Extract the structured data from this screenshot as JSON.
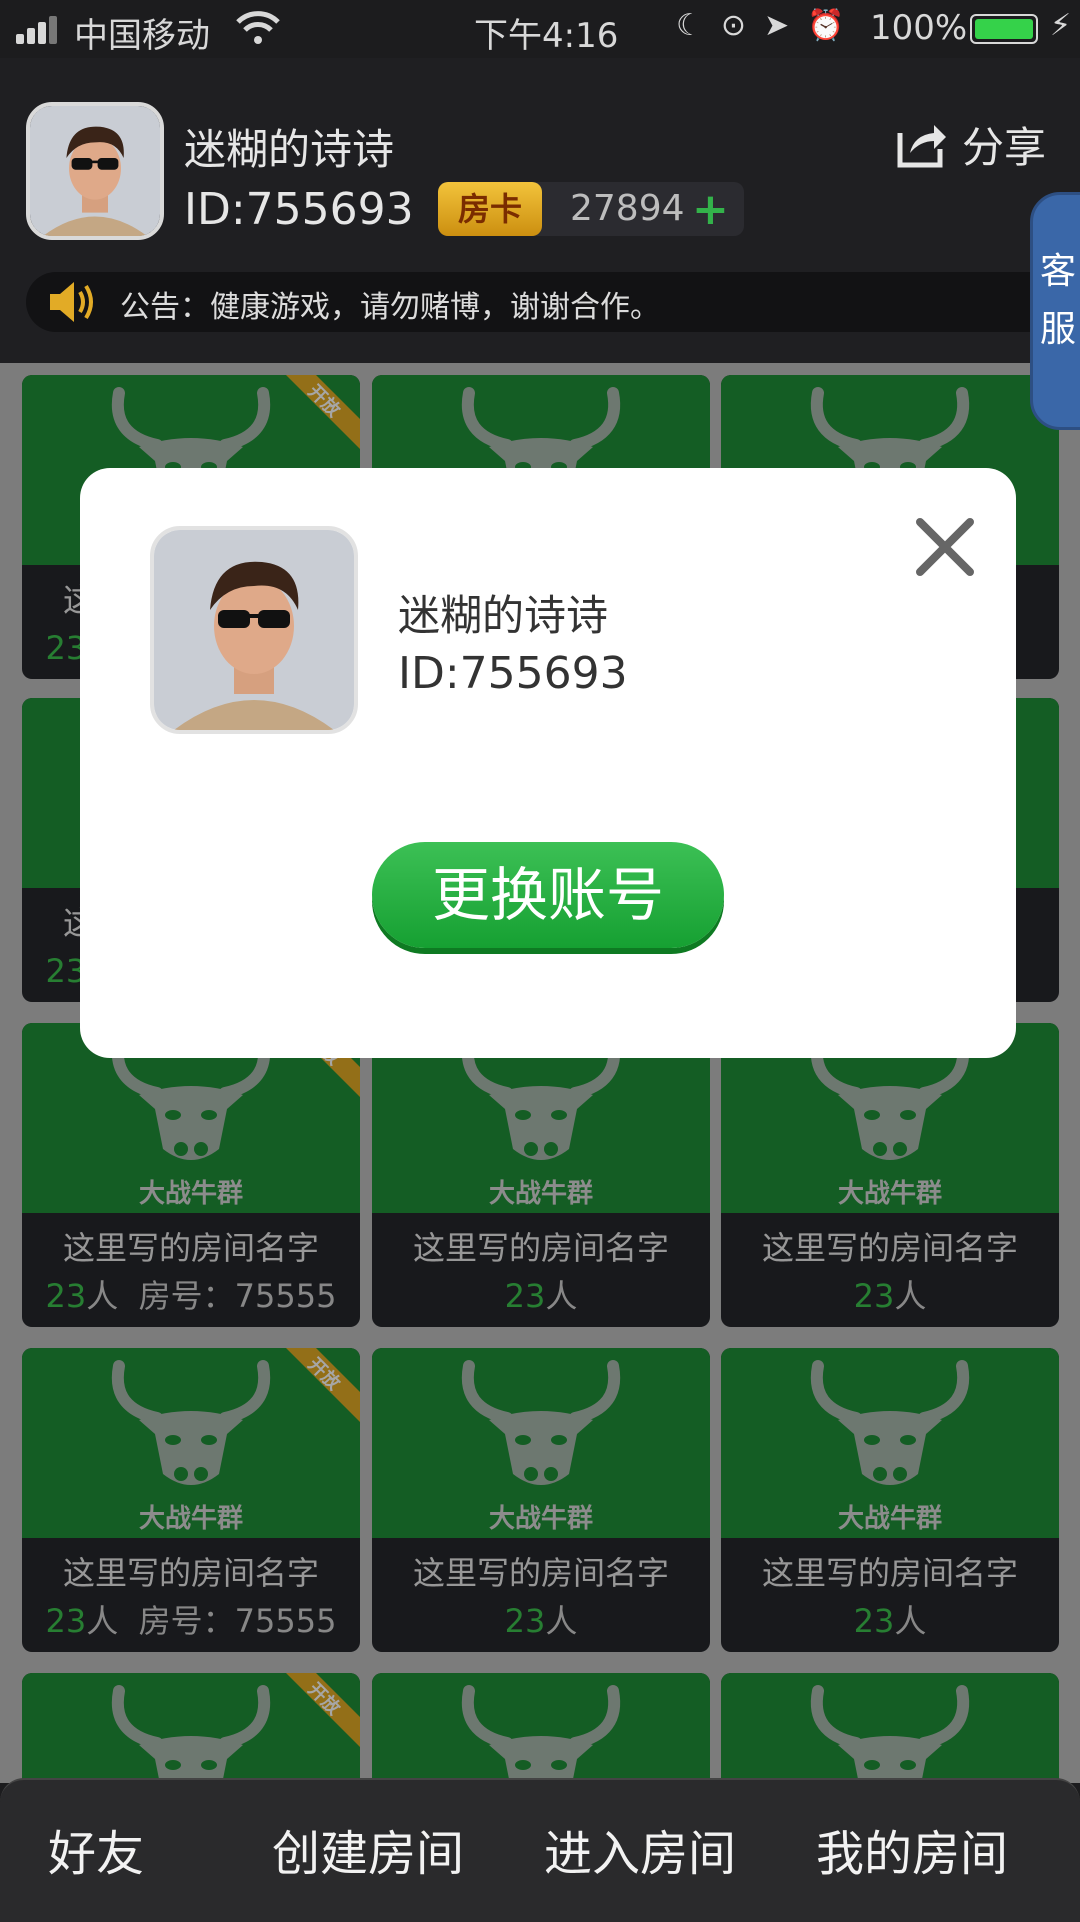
{
  "status_bar": {
    "carrier": "中国移动",
    "time": "下午4:16",
    "battery": "100%"
  },
  "user": {
    "name": "迷糊的诗诗",
    "id": "ID:755693"
  },
  "room_card": {
    "label": "房卡",
    "count": "27894",
    "add": "+"
  },
  "share": {
    "label": "分享"
  },
  "notice": {
    "text": "公告：健康游戏，请勿赌博，谢谢合作。"
  },
  "service": {
    "line1": "客",
    "line2": "服"
  },
  "rooms": {
    "brand": "大战牛群",
    "ribbon": "开放",
    "name": "这里写的房间名字",
    "count": "23",
    "people_unit": "人",
    "room_no": "房号：75555"
  },
  "modal": {
    "name": "迷糊的诗诗",
    "id": "ID:755693",
    "switch_button": "更换账号"
  },
  "bottom_nav": {
    "friends": "好友",
    "create": "创建房间",
    "enter": "进入房间",
    "mine": "我的房间"
  },
  "colors": {
    "green": "#1f8f38",
    "accent": "#3cc24e",
    "gold": "#e2ab26",
    "service_blue": "#3a67a8"
  }
}
